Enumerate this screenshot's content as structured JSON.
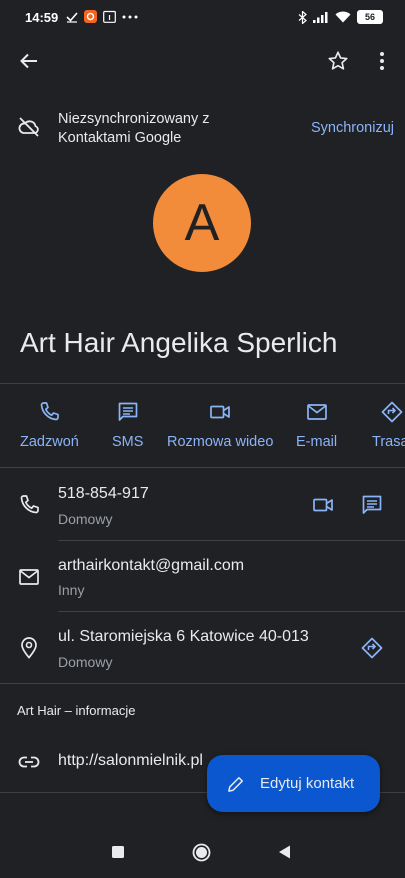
{
  "status_bar": {
    "time": "14:59",
    "battery": "56",
    "icons": [
      "check-icon",
      "app-notification-icon",
      "calendar-icon",
      "more-notifications-icon",
      "bluetooth-icon",
      "signal-icon",
      "wifi-icon",
      "battery-icon"
    ]
  },
  "app_bar": {
    "icons": [
      "back-arrow-icon",
      "star-icon",
      "more-vert-icon"
    ]
  },
  "sync": {
    "message": "Niezsynchronizowany z Kontaktami Google",
    "action": "Synchronizuj",
    "icon": "cloud-off-icon"
  },
  "contact": {
    "avatar_letter": "A",
    "avatar_color": "#f28b3a",
    "name": "Art Hair Angelika Sperlich"
  },
  "actions": [
    {
      "label": "Zadzwoń",
      "icon": "phone-icon"
    },
    {
      "label": "SMS",
      "icon": "message-icon"
    },
    {
      "label": "Rozmowa wideo",
      "icon": "videocam-icon"
    },
    {
      "label": "E-mail",
      "icon": "mail-icon"
    },
    {
      "label": "Trasa",
      "icon": "directions-icon"
    }
  ],
  "phone": {
    "value": "518-854-917",
    "type": "Domowy"
  },
  "email": {
    "value": "arthairkontakt@gmail.com",
    "type": "Inny"
  },
  "address": {
    "value": "ul. Staromiejska 6 Katowice 40-013",
    "type": "Domowy"
  },
  "about": {
    "title": "Art Hair – informacje",
    "website": "http://salonmielnik.pl"
  },
  "fab": {
    "label": "Edytuj kontakt",
    "icon": "edit-pencil-icon"
  },
  "colors": {
    "accent": "#8ab4f8",
    "background": "#202124",
    "fab": "#0b57d0"
  }
}
